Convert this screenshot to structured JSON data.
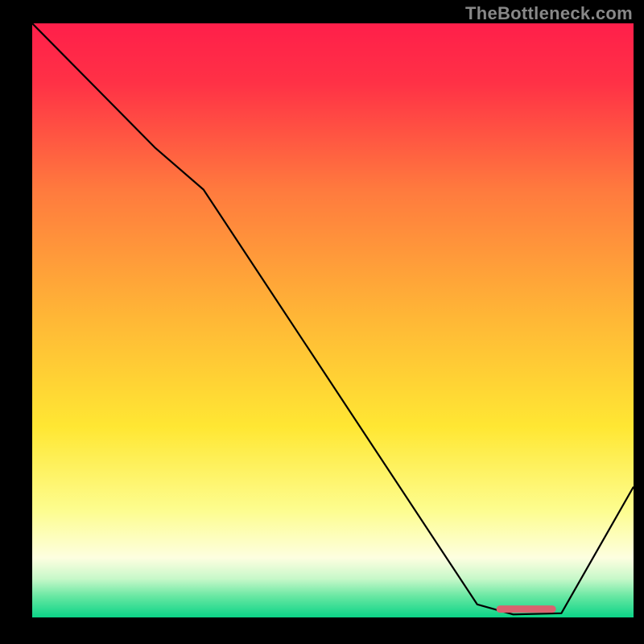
{
  "attribution": "TheBottleneck.com",
  "chart_data": {
    "type": "line",
    "title": "",
    "xlabel": "",
    "ylabel": "",
    "xlim": [
      0,
      100
    ],
    "ylim": [
      0,
      100
    ],
    "background_gradient_stops": [
      {
        "offset": 0.0,
        "color": "#ff1f4a"
      },
      {
        "offset": 0.1,
        "color": "#ff3146"
      },
      {
        "offset": 0.28,
        "color": "#ff7a3e"
      },
      {
        "offset": 0.5,
        "color": "#ffb836"
      },
      {
        "offset": 0.68,
        "color": "#ffe733"
      },
      {
        "offset": 0.82,
        "color": "#fdfd8f"
      },
      {
        "offset": 0.9,
        "color": "#fdfee0"
      },
      {
        "offset": 0.935,
        "color": "#c7f8c9"
      },
      {
        "offset": 0.965,
        "color": "#66e7a2"
      },
      {
        "offset": 1.0,
        "color": "#0bd487"
      }
    ],
    "series": [
      {
        "name": "bottleneck-curve",
        "type": "line",
        "color": "#000000",
        "stroke_width": 2.2,
        "x": [
          0,
          20.5,
          28.5,
          74,
          80,
          88,
          100
        ],
        "y": [
          100,
          79,
          72,
          2.2,
          0.5,
          0.7,
          22
        ]
      },
      {
        "name": "optimal-marker",
        "type": "segment",
        "color": "#d9636f",
        "stroke_width": 9,
        "linecap": "round",
        "x": [
          77.8,
          86.5
        ],
        "y": [
          1.4,
          1.4
        ]
      }
    ]
  }
}
